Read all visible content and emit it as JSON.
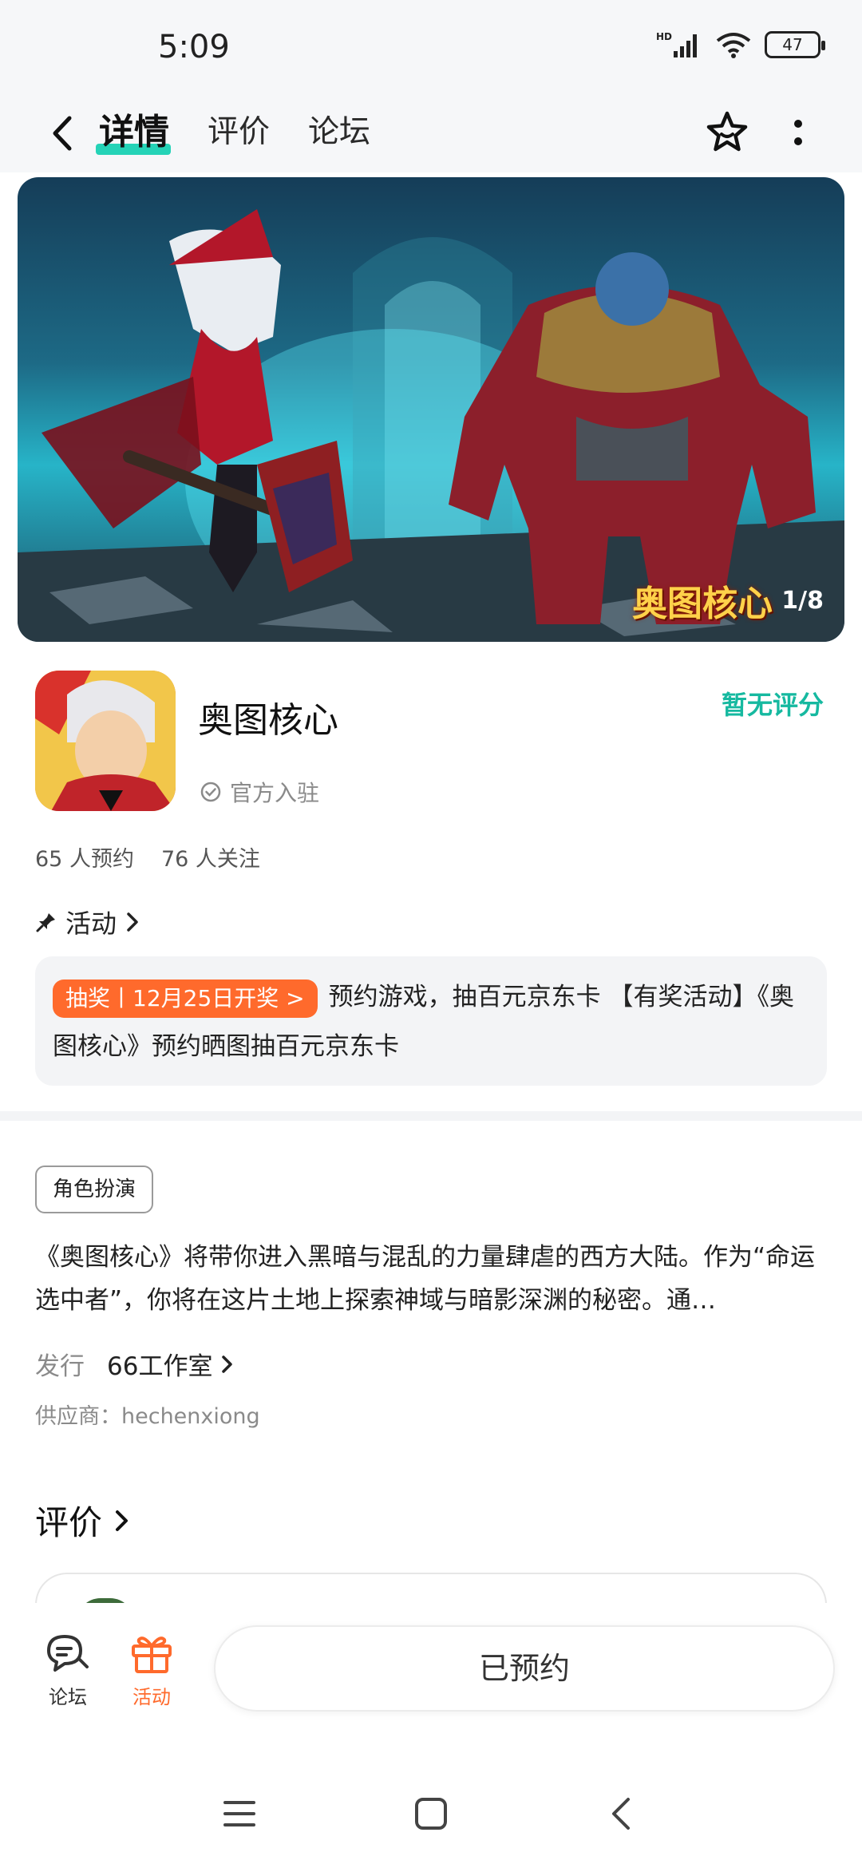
{
  "status_bar": {
    "time": "5:09",
    "battery": "47",
    "network": "HD"
  },
  "nav": {
    "tabs": [
      {
        "label": "详情",
        "active": true
      },
      {
        "label": "评价",
        "active": false
      },
      {
        "label": "论坛",
        "active": false
      }
    ]
  },
  "banner": {
    "logo_text": "奥图核心",
    "counter": "1/8"
  },
  "app": {
    "name": "奥图核心",
    "official_label": "官方入驻",
    "rating_text": "暂无评分",
    "reservations": "65 人预约",
    "followers": "76 人关注"
  },
  "activity": {
    "section_label": "活动",
    "badge": "抽奖丨12月25日开奖 >",
    "text": "预约游戏，抽百元京东卡 【有奖活动】《奥图核心》预约晒图抽百元京东卡"
  },
  "details": {
    "genre_tag": "角色扮演",
    "description": "《奥图核心》将带你进入黑暗与混乱的力量肆虐的西方大陆。作为“命运选中者”，你将在这片土地上探索神域与暗影深渊的秘密。通…",
    "publisher_label": "发行",
    "publisher_name": "66工作室",
    "supplier": "供应商：hechenxiong"
  },
  "reviews": {
    "heading": "评价"
  },
  "bottom_bar": {
    "forum_label": "论坛",
    "activity_label": "活动",
    "reserve_button": "已预约"
  },
  "colors": {
    "accent": "#25d3b7",
    "rating": "#16b9a0",
    "activity_orange": "#ff6a2c"
  }
}
